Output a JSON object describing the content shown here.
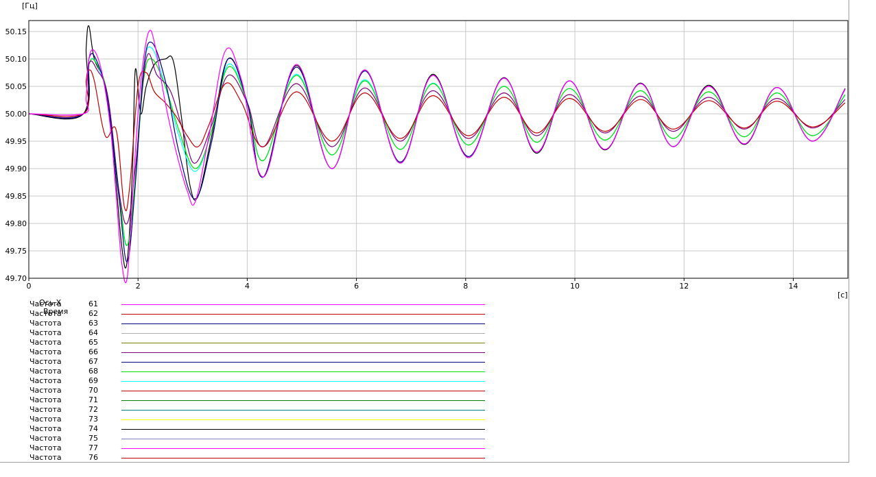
{
  "chart_data": {
    "type": "line",
    "y_unit": "[Гц]",
    "x_unit": "[с]",
    "xlim": [
      0,
      15
    ],
    "ylim": [
      49.7,
      50.17
    ],
    "x_ticks": [
      0,
      2,
      4,
      6,
      8,
      10,
      12,
      14
    ],
    "y_ticks": [
      49.7,
      49.75,
      49.8,
      49.85,
      49.9,
      49.95,
      50.0,
      50.05,
      50.1,
      50.15
    ],
    "x_tick_labels": [
      "0",
      "2",
      "4",
      "6",
      "8",
      "10",
      "12",
      "14"
    ],
    "y_tick_labels": [
      "49.70",
      "49.75",
      "49.80",
      "49.85",
      "49.90",
      "49.95",
      "50.00",
      "50.05",
      "50.10",
      "50.15"
    ],
    "grid": true,
    "legend_header": {
      "axis_label": "Ось X",
      "axis_name": "Время"
    },
    "series": [
      {
        "name": "Частота",
        "id": "61",
        "color": "#ff00ff",
        "x": [
          0,
          1.0,
          1.05,
          1.1,
          1.2,
          1.35,
          1.5,
          1.6,
          1.7,
          1.8,
          1.9,
          2.0,
          2.1,
          2.2,
          2.3,
          2.5,
          2.7,
          2.9,
          3.05,
          3.3,
          3.6,
          3.9,
          4.3,
          4.9,
          5.55,
          6.15,
          6.8,
          7.4,
          8.05,
          8.7,
          9.3,
          9.9,
          10.55,
          11.2,
          11.8,
          12.45,
          13.1,
          13.7,
          14.35,
          14.95
        ],
        "values": [
          50.0,
          50.0,
          50.03,
          50.1,
          50.115,
          50.07,
          49.97,
          49.85,
          49.73,
          49.7,
          49.85,
          50.0,
          50.1,
          50.15,
          50.13,
          50.02,
          49.93,
          49.86,
          49.84,
          49.96,
          50.115,
          50.06,
          49.885,
          50.09,
          49.9,
          50.08,
          49.91,
          50.07,
          49.92,
          50.065,
          49.93,
          50.06,
          49.935,
          50.055,
          49.94,
          50.05,
          49.945,
          50.048,
          49.95,
          50.045
        ]
      },
      {
        "name": "Частота",
        "id": "62",
        "color": "#c00000",
        "x": [
          0,
          1.0,
          1.05,
          1.1,
          1.2,
          1.4,
          1.6,
          1.75,
          1.85,
          2.0,
          2.15,
          2.3,
          2.5,
          2.7,
          2.9,
          3.1,
          3.3,
          3.6,
          3.9,
          4.3,
          4.9,
          5.55,
          6.15,
          6.8,
          7.4,
          8.05,
          8.7,
          9.3,
          9.9,
          10.55,
          11.2,
          11.8,
          12.45,
          13.1,
          13.7,
          14.35,
          14.95
        ],
        "values": [
          50.0,
          50.0,
          50.06,
          50.08,
          50.06,
          49.96,
          49.97,
          49.83,
          49.87,
          50.05,
          50.075,
          50.04,
          50.02,
          49.995,
          49.96,
          49.94,
          49.98,
          50.055,
          50.02,
          49.94,
          50.04,
          49.95,
          50.038,
          49.955,
          50.033,
          49.96,
          50.03,
          49.965,
          50.028,
          49.968,
          50.026,
          49.972,
          50.024,
          49.974,
          50.023,
          49.976,
          50.02
        ]
      },
      {
        "name": "Частота",
        "id": "63",
        "color": "#000080",
        "x": [
          0,
          1.0,
          1.1,
          1.25,
          1.45,
          1.65,
          1.8,
          1.95,
          2.1,
          2.25,
          2.5,
          2.75,
          3.05,
          3.35,
          3.65,
          4.0,
          4.3,
          4.9,
          5.55,
          6.15,
          6.8,
          7.4,
          8.05,
          8.7,
          9.3,
          9.9,
          10.55,
          11.2,
          11.8,
          12.45,
          13.1,
          13.7,
          14.35,
          14.95
        ],
        "values": [
          50.0,
          50.0,
          50.1,
          50.095,
          50.02,
          49.85,
          49.73,
          49.87,
          50.08,
          50.13,
          50.06,
          49.93,
          49.845,
          49.95,
          50.1,
          50.02,
          49.885,
          50.085,
          49.9,
          50.078,
          49.912,
          50.07,
          49.922,
          50.065,
          49.93,
          50.06,
          49.935,
          50.055,
          49.94,
          50.05,
          49.945,
          50.048,
          49.95,
          50.045
        ]
      },
      {
        "name": "Частота",
        "id": "64",
        "color": "#b0b0b0",
        "x": [],
        "values": []
      },
      {
        "name": "Частота",
        "id": "65",
        "color": "#808000",
        "x": [],
        "values": []
      },
      {
        "name": "Частота",
        "id": "66",
        "color": "#800080",
        "x": [
          0,
          1.0,
          1.1,
          1.25,
          1.45,
          1.65,
          1.8,
          1.95,
          2.15,
          2.35,
          2.6,
          2.85,
          3.05,
          3.35,
          3.65,
          4.0,
          4.3,
          4.9,
          5.55,
          6.15,
          6.8,
          7.4,
          8.05,
          8.7,
          9.3,
          9.9,
          10.55,
          11.2,
          11.8,
          12.45,
          13.1,
          13.7,
          14.35,
          14.95
        ],
        "values": [
          50.0,
          50.0,
          50.09,
          50.08,
          50.03,
          49.86,
          49.8,
          49.9,
          50.1,
          50.07,
          50.04,
          49.96,
          49.91,
          49.98,
          50.07,
          50.02,
          49.94,
          50.055,
          49.94,
          50.047,
          49.95,
          50.042,
          49.955,
          50.038,
          49.96,
          50.035,
          49.965,
          50.032,
          49.968,
          50.03,
          49.972,
          50.028,
          49.974,
          50.026
        ]
      },
      {
        "name": "Частота",
        "id": "67",
        "color": "#000080",
        "x": [],
        "values": []
      },
      {
        "name": "Частота",
        "id": "68",
        "color": "#00e000",
        "x": [
          0,
          1.0,
          1.1,
          1.25,
          1.45,
          1.65,
          1.8,
          1.95,
          2.1,
          2.25,
          2.5,
          2.75,
          3.05,
          3.35,
          3.65,
          4.0,
          4.3,
          4.9,
          5.55,
          6.15,
          6.8,
          7.4,
          8.05,
          8.7,
          9.3,
          9.9,
          10.55,
          11.2,
          11.8,
          12.45,
          13.1,
          13.7,
          14.35,
          14.95
        ],
        "values": [
          50.0,
          50.0,
          50.09,
          50.09,
          50.03,
          49.86,
          49.76,
          49.88,
          50.06,
          50.1,
          50.05,
          49.97,
          49.9,
          49.97,
          50.085,
          50.02,
          49.915,
          50.07,
          49.925,
          50.06,
          49.935,
          50.055,
          49.943,
          50.05,
          49.948,
          50.046,
          49.952,
          50.042,
          49.955,
          50.04,
          49.958,
          50.038,
          49.96,
          50.035
        ]
      },
      {
        "name": "Частота",
        "id": "69",
        "color": "#00ffff",
        "x": [
          0,
          1.0,
          1.1,
          1.25,
          1.45,
          1.65,
          1.8,
          1.95,
          2.1,
          2.25,
          2.5,
          2.75,
          3.05,
          3.35,
          3.65,
          4.0,
          4.3,
          4.9,
          5.55,
          6.15,
          6.8,
          7.4,
          8.05,
          8.7,
          9.3,
          9.9,
          10.55,
          11.2,
          11.8,
          12.45,
          13.1,
          13.7,
          14.35,
          14.95
        ],
        "values": [
          50.0,
          50.0,
          50.09,
          50.09,
          50.02,
          49.85,
          49.76,
          49.88,
          50.08,
          50.12,
          50.05,
          49.96,
          49.895,
          49.97,
          50.09,
          50.02,
          49.915,
          50.072,
          49.925,
          50.062,
          49.935,
          50.056,
          49.943,
          50.05,
          49.948,
          50.046,
          49.952,
          50.042,
          49.955,
          50.04,
          49.958,
          50.038,
          49.96,
          50.034
        ]
      },
      {
        "name": "Частота",
        "id": "70",
        "color": "#c00000",
        "x": [],
        "values": []
      },
      {
        "name": "Частота",
        "id": "71",
        "color": "#008000",
        "x": [],
        "values": []
      },
      {
        "name": "Частота",
        "id": "72",
        "color": "#008080",
        "x": [],
        "values": []
      },
      {
        "name": "Частота",
        "id": "73",
        "color": "#ffff00",
        "x": [],
        "values": []
      },
      {
        "name": "Частота",
        "id": "74",
        "color": "#000000",
        "x": [
          0,
          1.0,
          1.05,
          1.1,
          1.2,
          1.4,
          1.55,
          1.7,
          1.8,
          1.9,
          1.95,
          2.05,
          2.15,
          2.3,
          2.5,
          2.65,
          2.8,
          2.95,
          3.1,
          3.35,
          3.65,
          4.0,
          4.3,
          4.9,
          5.55,
          6.15,
          6.8,
          7.4,
          8.05,
          8.7,
          9.3,
          9.9,
          10.55,
          11.2,
          11.8,
          12.45,
          13.1,
          13.7,
          14.35,
          14.95
        ],
        "values": [
          50.0,
          50.0,
          50.12,
          50.16,
          50.1,
          50.05,
          49.93,
          49.76,
          49.73,
          49.9,
          50.08,
          50.0,
          50.05,
          50.09,
          50.1,
          50.095,
          49.99,
          49.87,
          49.85,
          49.96,
          50.1,
          50.02,
          49.885,
          50.088,
          49.9,
          50.08,
          49.91,
          50.072,
          49.92,
          50.066,
          49.928,
          50.06,
          49.934,
          50.056,
          49.94,
          50.052,
          49.944,
          50.048,
          49.95,
          50.046
        ]
      },
      {
        "name": "Частота",
        "id": "75",
        "color": "#8080c0",
        "x": [],
        "values": []
      },
      {
        "name": "Частота",
        "id": "77",
        "color": "#ff00ff",
        "x": [],
        "values": []
      },
      {
        "name": "Частота",
        "id": "76",
        "color": "#c00000",
        "x": [],
        "values": []
      }
    ]
  }
}
